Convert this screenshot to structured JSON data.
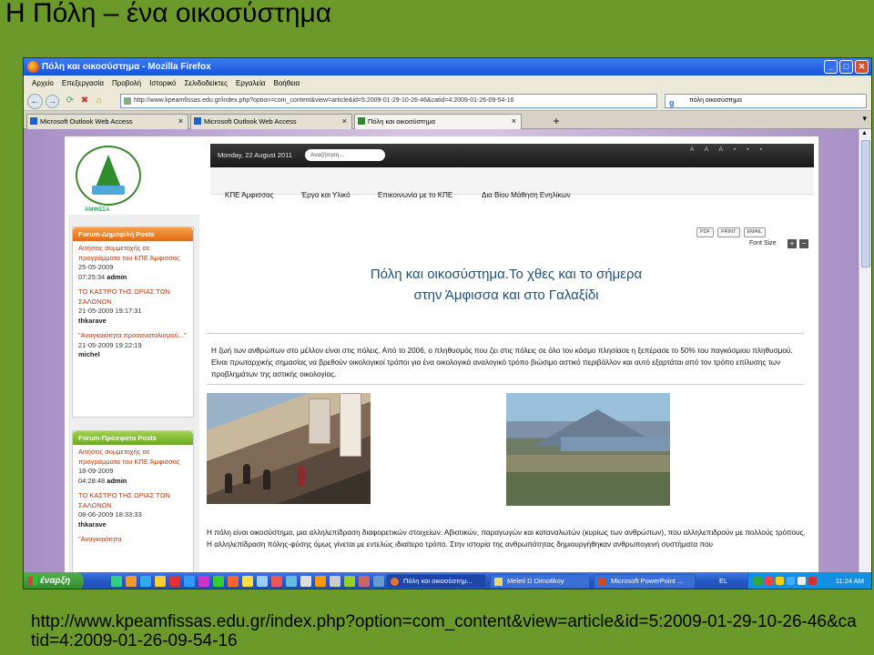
{
  "slide": {
    "title": "Η Πόλη – ένα οικοσύστημα",
    "url": "http://www.kpeamfissas.edu.gr/index.php?option=com_content&view=article&id=5:2009-01-29-10-26-46&catid=4:2009-01-26-09-54-16"
  },
  "browser": {
    "window_title": "Πόλη και οικοσύστημα - Mozilla Firefox",
    "window_buttons": [
      "_",
      "□",
      "✕"
    ],
    "menu": [
      "Αρχείο",
      "Επεξεργασία",
      "Προβολή",
      "Ιστορικό",
      "Σελιδοδείκτες",
      "Εργαλεία",
      "Βοήθεια"
    ],
    "address": "http://www.kpeamfissas.edu.gr/index.php?option=com_content&view=article&id=5:2009-01-29-10-26-46&catid=4:2009-01-26-09-54-16",
    "search_value": "πόλη οικοσύστημα",
    "search_engine_glyph": "g",
    "tabs": [
      {
        "label": "Microsoft Outlook Web Access",
        "close": "×"
      },
      {
        "label": "Microsoft Outlook Web Access",
        "close": "×"
      },
      {
        "label": "Πόλη και οικοσύστημα",
        "close": "×"
      }
    ],
    "new_tab": "+",
    "nav_back": "←",
    "nav_forward": "→"
  },
  "site": {
    "logo_text": "ΑΜΦΙΣΣΑ",
    "date": "Monday, 22 August 2011",
    "search_placeholder": "Αναζήτηση...",
    "font_controls": "A A A ▪ ▪ ▪",
    "nav": [
      "ΚΠΕ Άμφισσας",
      "Έργα και Υλικό",
      "Επικοινωνία με το ΚΠΕ",
      "Δια Βίου Μάθηση Ενηλίκων"
    ],
    "popular": {
      "heading": "Forum-Δημοφιλή Posts",
      "posts": [
        {
          "title": "Αιτήσεις συμμετοχής σε προγράμματα του ΚΠΕ Άμφισσας",
          "date": "25-05-2009",
          "time": "07:25:34",
          "author": "admin"
        },
        {
          "title": "ΤΟ ΚΑΣΤΡΟ ΤΗΣ ΩΡΙΑΣ ΤΩΝ ΣΑΛΩΝΩΝ",
          "date": "21-05-2009 19:17:31",
          "author": "thkarave"
        },
        {
          "title": "\"Αναγκαιότητα προσανατολισμού...\"",
          "date": "21-05-2009 19:22:19",
          "author": "michel"
        }
      ]
    },
    "recent": {
      "heading": "Forum-Πρόσφατα Posts",
      "posts": [
        {
          "title": "Αιτήσεις συμμετοχής σε προγράμματα του ΚΠΕ Άμφισσας",
          "date": "18-09-2009",
          "time": "04:28:48",
          "author": "admin"
        },
        {
          "title": "ΤΟ ΚΑΣΤΡΟ ΤΗΣ ΩΡΙΑΣ ΤΩΝ ΣΑΛΩΝΩΝ",
          "date": "08-06-2009 18:33:33",
          "author": "thkarave"
        },
        {
          "title": "\"Αναγκαιότητα",
          "date": "",
          "author": ""
        }
      ]
    },
    "article": {
      "icons": [
        "PDF",
        "PRINT",
        "EMAIL"
      ],
      "font_size_label": "Font Size",
      "font_plus": "+",
      "font_minus": "−",
      "title_line1": "Πόλη και οικοσύστημα.Το χθες και το σήμερα",
      "title_line2": "στην Άμφισσα και στο Γαλαξίδι",
      "intro": "Η ζωή των ανθρώπων στο μέλλον είναι στις πόλεις. Από το 2006, ο πληθυσμός που ζει στις πόλεις σε όλο τον κόσμο πλησίασε η ξεπέρασε το 50% του παγκόσμιου πληθυσμού. Είναι πρωταρχικής σημασίας να βρεθούν οικολογικοί τρόποι για ένα οικολογικά αναλογικό τρόπο βιώσιμο αστικό περιβάλλον και αυτό εξαρτάται από τον τρόπο επίλυσης των προβλημάτων της αστικής οικολογίας.",
      "body": "Η πόλη είναι οικοσύστημα, μια αλληλεπίδραση διαφορετικών στοιχείων. Αβιοτικών, παραγωγών και καταναλωτών (κυρίως των ανθρώπων), που αλληλεπιδρούν με πολλούς τρόπους. Η αλληλεπίδραση πόλης-φύσης όμως γίνεται με εντελώς ιδιαίτερο τρόπο. Στην ιστορία της ανθρωπότητας δημιουργήθηκαν ανθρωπογενή συστήματα που"
    }
  },
  "taskbar": {
    "start": "έναρξη",
    "buttons": [
      {
        "label": "Πόλη και οικοσύστημ..."
      },
      {
        "label": "Meleti D Dimotikoy"
      },
      {
        "label": "Microsoft PowerPoint ..."
      }
    ],
    "language": "EL",
    "clock": "11:24 AM"
  }
}
